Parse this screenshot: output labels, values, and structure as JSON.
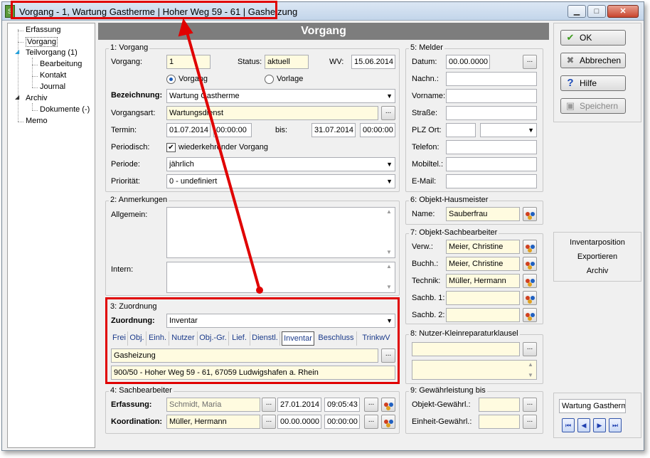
{
  "window": {
    "title": "Vorgang - 1, Wartung Gastherme | Hoher Weg 59 - 61 | Gasheizung",
    "app_icon_glyph": "S",
    "min_glyph": "▁",
    "max_glyph": "□",
    "close_glyph": "✕"
  },
  "tree": {
    "items": [
      "Erfassung",
      "Vorgang",
      "Teilvorgang (1)",
      "Bearbeitung",
      "Kontakt",
      "Journal",
      "Archiv",
      "Dokumente (-)",
      "Memo"
    ],
    "expander_open": "◢",
    "expander_collapsed": "▸"
  },
  "header": {
    "title": "Vorgang"
  },
  "vorgang": {
    "group_label": "1: Vorgang",
    "vorgang_label": "Vorgang:",
    "vorgang_value": "1",
    "status_label": "Status:",
    "status_value": "aktuell",
    "wv_label": "WV:",
    "wv_value": "15.06.2014",
    "radio_vorgang": "Vorgang",
    "radio_vorlage": "Vorlage",
    "bezeichnung_label": "Bezeichnung:",
    "bezeichnung_value": "Wartung Gastherme",
    "vorgangsart_label": "Vorgangsart:",
    "vorgangsart_value": "Wartungsdienst",
    "termin_label": "Termin:",
    "termin_date": "01.07.2014",
    "termin_time": "00:00:00",
    "bis_label": "bis:",
    "bis_date": "31.07.2014",
    "bis_time": "00:00:00",
    "periodisch_label": "Periodisch:",
    "periodisch_check": "✔",
    "periodisch_text": "wiederkehrender Vorgang",
    "periode_label": "Periode:",
    "periode_value": "jährlich",
    "prioritaet_label": "Priorität:",
    "prioritaet_value": "0 - undefiniert"
  },
  "anmerkungen": {
    "group_label": "2: Anmerkungen",
    "allgemein_label": "Allgemein:",
    "intern_label": "Intern:"
  },
  "zuordnung": {
    "group_label": "3: Zuordnung",
    "label": "Zuordnung:",
    "value": "Inventar",
    "tabs": [
      "Frei",
      "Obj.",
      "Einh.",
      "Nutzer",
      "Obj.-Gr.",
      "Lief.",
      "Dienstl.",
      "Inventar",
      "Beschluss",
      "TrinkwV"
    ],
    "item_value": "Gasheizung",
    "address": "900/50 - Hoher Weg 59 - 61, 67059 Ludwigshafen a. Rhein"
  },
  "sachbearbeiter": {
    "group_label": "4: Sachbearbeiter",
    "erfassung_label": "Erfassung:",
    "erfassung_name": "Schmidt, Maria",
    "erfassung_date": "27.01.2014",
    "erfassung_time": "09:05:43",
    "koordination_label": "Koordination:",
    "koordination_name": "Müller, Hermann",
    "koordination_date": "00.00.0000",
    "koordination_time": "00:00:00"
  },
  "melder": {
    "group_label": "5: Melder",
    "datum_label": "Datum:",
    "datum_value": "00.00.0000",
    "nachname_label": "Nachn.:",
    "vorname_label": "Vorname:",
    "strasse_label": "Straße:",
    "plz_label": "PLZ Ort:",
    "telefon_label": "Telefon:",
    "mobil_label": "Mobiltel.:",
    "email_label": "E-Mail:"
  },
  "hausmeister": {
    "group_label": "6: Objekt-Hausmeister",
    "name_label": "Name:",
    "name_value": "Sauberfrau"
  },
  "objekt_sachbearbeiter": {
    "group_label": "7: Objekt-Sachbearbeiter",
    "rows": [
      {
        "label": "Verw.:",
        "value": "Meier, Christine"
      },
      {
        "label": "Buchh.:",
        "value": "Meier, Christine"
      },
      {
        "label": "Technik:",
        "value": "Müller, Hermann"
      },
      {
        "label": "Sachb. 1:",
        "value": ""
      },
      {
        "label": "Sachb. 2:",
        "value": ""
      }
    ]
  },
  "nutzer_klausel": {
    "group_label": "8: Nutzer-Kleinreparaturklausel"
  },
  "gewaehrleistung": {
    "group_label": "9: Gewährleistung bis",
    "objekt_label": "Objekt-Gewährl.:",
    "einheit_label": "Einheit-Gewährl.:"
  },
  "buttons": {
    "ok": "OK",
    "abbrechen": "Abbrechen",
    "hilfe": "Hilfe",
    "speichern": "Speichern",
    "ok_icon": "✔",
    "abbrechen_icon": "✖",
    "hilfe_icon": "?",
    "speichern_icon": "▣"
  },
  "links": [
    "Inventarposition",
    "Exportieren",
    "Archiv"
  ],
  "record": {
    "current": "Wartung Gastherme",
    "first": "⏮",
    "prev": "◀",
    "next": "▶",
    "last": "⏭"
  },
  "common": {
    "dots": "...",
    "arrow_down": "▼",
    "scroll_up": "▲",
    "scroll_down": "▼"
  },
  "colors": {
    "highlight": "#e00000",
    "field_yellow": "#fffbe0",
    "header_gray": "#7d7d7d"
  }
}
